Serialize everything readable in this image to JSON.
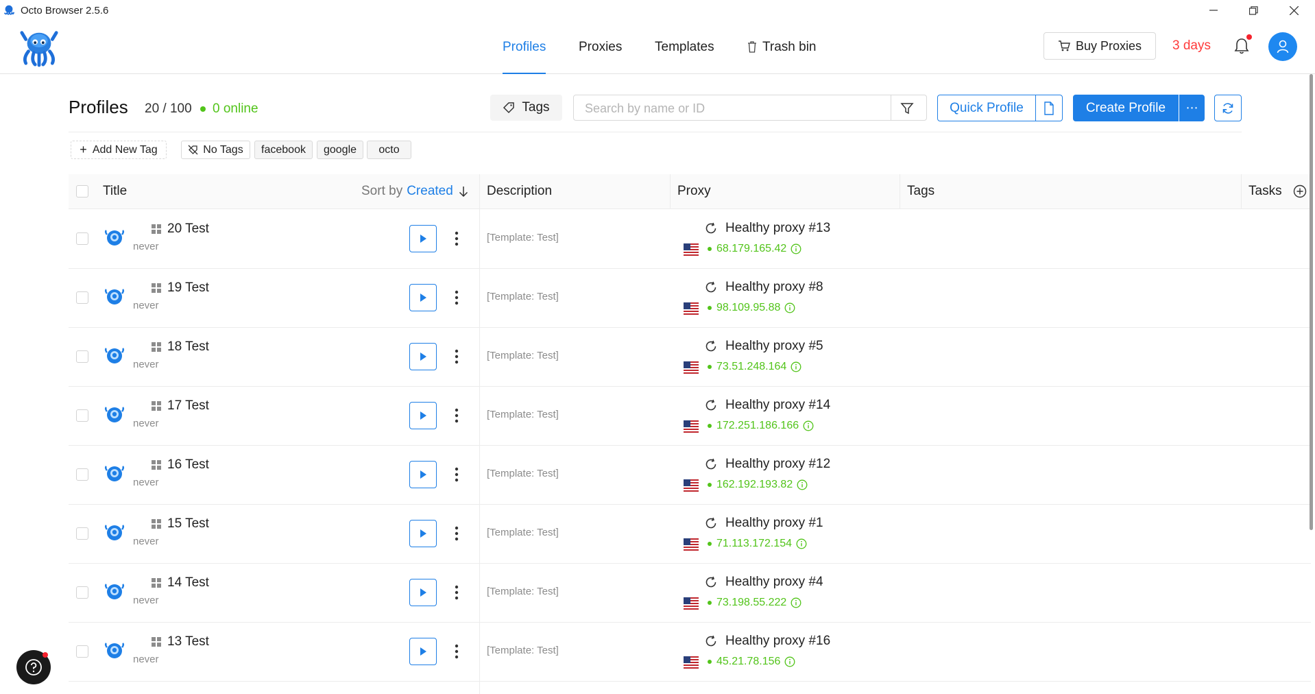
{
  "window": {
    "title": "Octo Browser 2.5.6"
  },
  "nav": {
    "tabs": [
      {
        "label": "Profiles",
        "active": true
      },
      {
        "label": "Proxies",
        "active": false
      },
      {
        "label": "Templates",
        "active": false
      },
      {
        "label": "Trash bin",
        "active": false
      }
    ],
    "buy_proxies": "Buy Proxies",
    "days_left": "3 days"
  },
  "toolbar": {
    "title": "Profiles",
    "count": "20 / 100",
    "online": "0 online",
    "tags_label": "Tags",
    "search_placeholder": "Search by name or ID",
    "quick_profile": "Quick Profile",
    "create_profile": "Create Profile",
    "more": "⋯"
  },
  "tags": {
    "add": "Add New Tag",
    "no_tags": "No Tags",
    "items": [
      "facebook",
      "google",
      "octo"
    ]
  },
  "table": {
    "headers": {
      "title": "Title",
      "sort_by": "Sort by",
      "sort_field": "Created",
      "description": "Description",
      "proxy": "Proxy",
      "tags": "Tags",
      "tasks": "Tasks"
    },
    "rows": [
      {
        "name": "20 Test",
        "last": "never",
        "desc": "[Template: Test]",
        "proxy": "Healthy proxy #13",
        "ip": "68.179.165.42"
      },
      {
        "name": "19 Test",
        "last": "never",
        "desc": "[Template: Test]",
        "proxy": "Healthy proxy #8",
        "ip": "98.109.95.88"
      },
      {
        "name": "18 Test",
        "last": "never",
        "desc": "[Template: Test]",
        "proxy": "Healthy proxy #5",
        "ip": "73.51.248.164"
      },
      {
        "name": "17 Test",
        "last": "never",
        "desc": "[Template: Test]",
        "proxy": "Healthy proxy #14",
        "ip": "172.251.186.166"
      },
      {
        "name": "16 Test",
        "last": "never",
        "desc": "[Template: Test]",
        "proxy": "Healthy proxy #12",
        "ip": "162.192.193.82"
      },
      {
        "name": "15 Test",
        "last": "never",
        "desc": "[Template: Test]",
        "proxy": "Healthy proxy #1",
        "ip": "71.113.172.154"
      },
      {
        "name": "14 Test",
        "last": "never",
        "desc": "[Template: Test]",
        "proxy": "Healthy proxy #4",
        "ip": "73.198.55.222"
      },
      {
        "name": "13 Test",
        "last": "never",
        "desc": "[Template: Test]",
        "proxy": "Healthy proxy #16",
        "ip": "45.21.78.156"
      }
    ]
  },
  "colors": {
    "accent": "#1e7fe6",
    "online": "#52c41a",
    "warning": "#ff3b3b"
  }
}
